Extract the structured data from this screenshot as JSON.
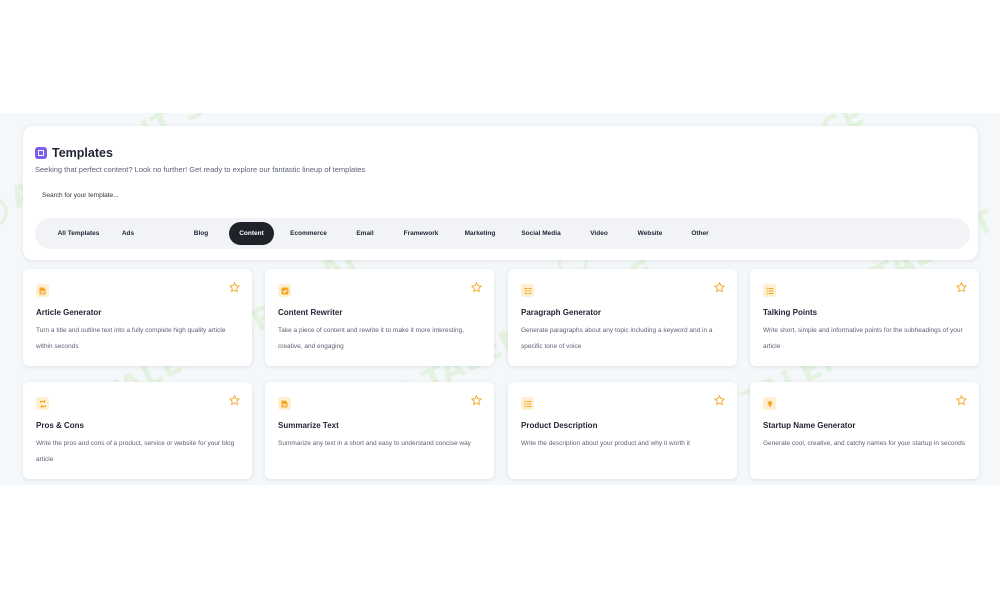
{
  "page": {
    "title": "Templates",
    "subtitle": "Seeking that perfect content? Look no further! Get ready to explore our fantastic lineup of templates",
    "watermark": "AI TALENT SPACE"
  },
  "search": {
    "placeholder": "Search for your template..."
  },
  "tabs": [
    {
      "label": "All Templates"
    },
    {
      "label": "Ads"
    },
    {
      "label": "Blog"
    },
    {
      "label": "Content",
      "active": true
    },
    {
      "label": "Ecommerce"
    },
    {
      "label": "Email"
    },
    {
      "label": "Framework"
    },
    {
      "label": "Marketing"
    },
    {
      "label": "Social Media"
    },
    {
      "label": "Video"
    },
    {
      "label": "Website"
    },
    {
      "label": "Other"
    }
  ],
  "cards": [
    {
      "icon": "document-icon",
      "title": "Article Generator",
      "description": "Turn a title and outline text into a fully complete high quality article within seconds"
    },
    {
      "icon": "checkbox-icon",
      "title": "Content Rewriter",
      "description": "Take a piece of content and rewrite it to make it more interesting, creative, and engaging"
    },
    {
      "icon": "paragraph-icon",
      "title": "Paragraph Generator",
      "description": "Generate paragraphs about any topic including a keyword and in a specific tone of voice"
    },
    {
      "icon": "list-icon",
      "title": "Talking Points",
      "description": "Write short, simple and informative points for the subheadings of your article"
    },
    {
      "icon": "swap-icon",
      "title": "Pros & Cons",
      "description": "Write the pros and cons of a product, service or website for your blog article"
    },
    {
      "icon": "document-icon",
      "title": "Summarize Text",
      "description": "Summarize any text in a short and easy to understand concise way"
    },
    {
      "icon": "list-icon",
      "title": "Product Description",
      "description": "Write the description about your product and why it worth it"
    },
    {
      "icon": "lightbulb-icon",
      "title": "Startup Name Generator",
      "description": "Generate cool, creative, and catchy names for your startup in seconds"
    }
  ],
  "colors": {
    "accent_orange": "#f5a623",
    "icon_bg": "#fdefd0",
    "title_icon": "#7d5cf0",
    "active_tab": "#1f2329"
  }
}
